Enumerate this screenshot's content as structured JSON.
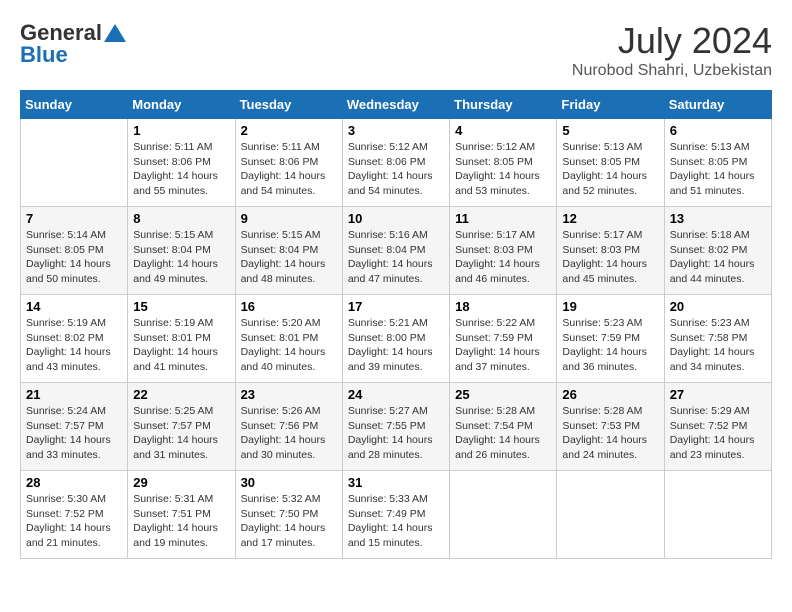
{
  "header": {
    "logo_line1": "General",
    "logo_line2": "Blue",
    "month": "July 2024",
    "location": "Nurobod Shahri, Uzbekistan"
  },
  "weekdays": [
    "Sunday",
    "Monday",
    "Tuesday",
    "Wednesday",
    "Thursday",
    "Friday",
    "Saturday"
  ],
  "weeks": [
    [
      {
        "day": "",
        "info": ""
      },
      {
        "day": "1",
        "info": "Sunrise: 5:11 AM\nSunset: 8:06 PM\nDaylight: 14 hours\nand 55 minutes."
      },
      {
        "day": "2",
        "info": "Sunrise: 5:11 AM\nSunset: 8:06 PM\nDaylight: 14 hours\nand 54 minutes."
      },
      {
        "day": "3",
        "info": "Sunrise: 5:12 AM\nSunset: 8:06 PM\nDaylight: 14 hours\nand 54 minutes."
      },
      {
        "day": "4",
        "info": "Sunrise: 5:12 AM\nSunset: 8:05 PM\nDaylight: 14 hours\nand 53 minutes."
      },
      {
        "day": "5",
        "info": "Sunrise: 5:13 AM\nSunset: 8:05 PM\nDaylight: 14 hours\nand 52 minutes."
      },
      {
        "day": "6",
        "info": "Sunrise: 5:13 AM\nSunset: 8:05 PM\nDaylight: 14 hours\nand 51 minutes."
      }
    ],
    [
      {
        "day": "7",
        "info": "Sunrise: 5:14 AM\nSunset: 8:05 PM\nDaylight: 14 hours\nand 50 minutes."
      },
      {
        "day": "8",
        "info": "Sunrise: 5:15 AM\nSunset: 8:04 PM\nDaylight: 14 hours\nand 49 minutes."
      },
      {
        "day": "9",
        "info": "Sunrise: 5:15 AM\nSunset: 8:04 PM\nDaylight: 14 hours\nand 48 minutes."
      },
      {
        "day": "10",
        "info": "Sunrise: 5:16 AM\nSunset: 8:04 PM\nDaylight: 14 hours\nand 47 minutes."
      },
      {
        "day": "11",
        "info": "Sunrise: 5:17 AM\nSunset: 8:03 PM\nDaylight: 14 hours\nand 46 minutes."
      },
      {
        "day": "12",
        "info": "Sunrise: 5:17 AM\nSunset: 8:03 PM\nDaylight: 14 hours\nand 45 minutes."
      },
      {
        "day": "13",
        "info": "Sunrise: 5:18 AM\nSunset: 8:02 PM\nDaylight: 14 hours\nand 44 minutes."
      }
    ],
    [
      {
        "day": "14",
        "info": "Sunrise: 5:19 AM\nSunset: 8:02 PM\nDaylight: 14 hours\nand 43 minutes."
      },
      {
        "day": "15",
        "info": "Sunrise: 5:19 AM\nSunset: 8:01 PM\nDaylight: 14 hours\nand 41 minutes."
      },
      {
        "day": "16",
        "info": "Sunrise: 5:20 AM\nSunset: 8:01 PM\nDaylight: 14 hours\nand 40 minutes."
      },
      {
        "day": "17",
        "info": "Sunrise: 5:21 AM\nSunset: 8:00 PM\nDaylight: 14 hours\nand 39 minutes."
      },
      {
        "day": "18",
        "info": "Sunrise: 5:22 AM\nSunset: 7:59 PM\nDaylight: 14 hours\nand 37 minutes."
      },
      {
        "day": "19",
        "info": "Sunrise: 5:23 AM\nSunset: 7:59 PM\nDaylight: 14 hours\nand 36 minutes."
      },
      {
        "day": "20",
        "info": "Sunrise: 5:23 AM\nSunset: 7:58 PM\nDaylight: 14 hours\nand 34 minutes."
      }
    ],
    [
      {
        "day": "21",
        "info": "Sunrise: 5:24 AM\nSunset: 7:57 PM\nDaylight: 14 hours\nand 33 minutes."
      },
      {
        "day": "22",
        "info": "Sunrise: 5:25 AM\nSunset: 7:57 PM\nDaylight: 14 hours\nand 31 minutes."
      },
      {
        "day": "23",
        "info": "Sunrise: 5:26 AM\nSunset: 7:56 PM\nDaylight: 14 hours\nand 30 minutes."
      },
      {
        "day": "24",
        "info": "Sunrise: 5:27 AM\nSunset: 7:55 PM\nDaylight: 14 hours\nand 28 minutes."
      },
      {
        "day": "25",
        "info": "Sunrise: 5:28 AM\nSunset: 7:54 PM\nDaylight: 14 hours\nand 26 minutes."
      },
      {
        "day": "26",
        "info": "Sunrise: 5:28 AM\nSunset: 7:53 PM\nDaylight: 14 hours\nand 24 minutes."
      },
      {
        "day": "27",
        "info": "Sunrise: 5:29 AM\nSunset: 7:52 PM\nDaylight: 14 hours\nand 23 minutes."
      }
    ],
    [
      {
        "day": "28",
        "info": "Sunrise: 5:30 AM\nSunset: 7:52 PM\nDaylight: 14 hours\nand 21 minutes."
      },
      {
        "day": "29",
        "info": "Sunrise: 5:31 AM\nSunset: 7:51 PM\nDaylight: 14 hours\nand 19 minutes."
      },
      {
        "day": "30",
        "info": "Sunrise: 5:32 AM\nSunset: 7:50 PM\nDaylight: 14 hours\nand 17 minutes."
      },
      {
        "day": "31",
        "info": "Sunrise: 5:33 AM\nSunset: 7:49 PM\nDaylight: 14 hours\nand 15 minutes."
      },
      {
        "day": "",
        "info": ""
      },
      {
        "day": "",
        "info": ""
      },
      {
        "day": "",
        "info": ""
      }
    ]
  ]
}
